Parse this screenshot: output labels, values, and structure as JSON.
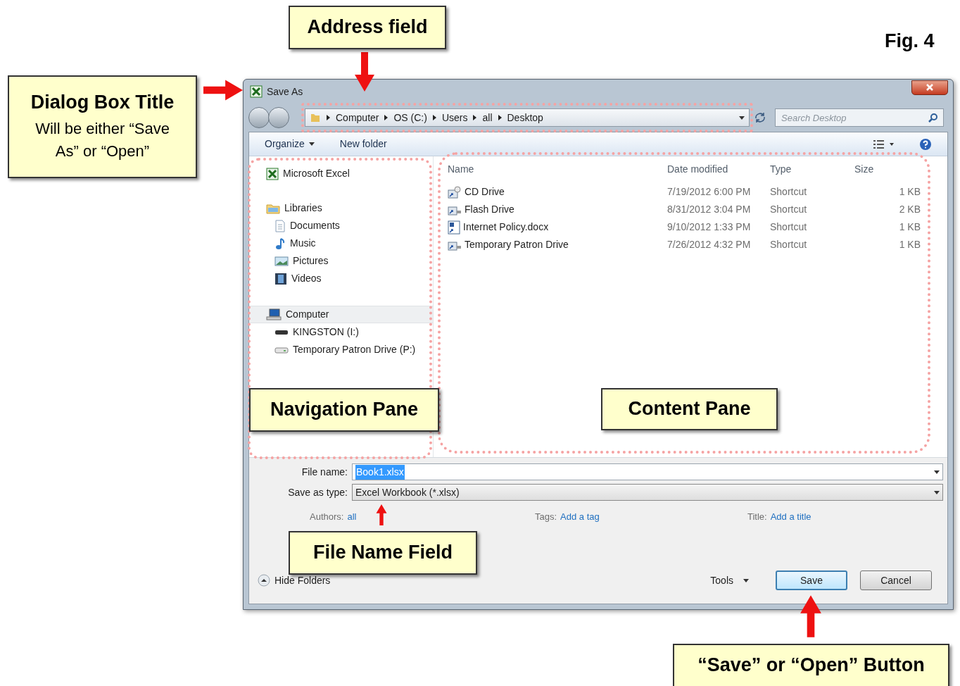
{
  "figure_label": "Fig. 4",
  "callouts": [
    {
      "title": "Address field"
    },
    {
      "title": "Dialog Box Title",
      "text": "Will be either “Save As” or “Open”"
    },
    {
      "title": "Navigation Pane"
    },
    {
      "title": "Content Pane"
    },
    {
      "title": "File Name Field"
    },
    {
      "title": "“Save” or “Open” Button"
    }
  ],
  "dialog": {
    "title": "Save As",
    "address": [
      "Computer",
      "OS (C:)",
      "Users",
      "all",
      "Desktop"
    ],
    "search": {
      "placeholder": "Search Desktop"
    },
    "toolbar": {
      "organize": "Organize",
      "new_folder": "New folder"
    },
    "navigation": [
      {
        "label": "Microsoft Excel",
        "kind": "app"
      },
      {
        "label": "Libraries",
        "kind": "library",
        "children": [
          {
            "label": "Documents",
            "kind": "documents"
          },
          {
            "label": "Music",
            "kind": "music"
          },
          {
            "label": "Pictures",
            "kind": "pictures"
          },
          {
            "label": "Videos",
            "kind": "videos"
          }
        ]
      },
      {
        "label": "Computer",
        "kind": "computer",
        "children": [
          {
            "label": "KINGSTON (I:)",
            "kind": "usb"
          },
          {
            "label": "Temporary Patron Drive (P:)",
            "kind": "network"
          }
        ]
      }
    ],
    "columns": [
      "Name",
      "Date modified",
      "Type",
      "Size"
    ],
    "files": [
      {
        "name": "CD Drive",
        "date": "7/19/2012 6:00 PM",
        "type": "Shortcut",
        "size": "1 KB",
        "kind": "cd"
      },
      {
        "name": "Flash Drive",
        "date": "8/31/2012 3:04 PM",
        "type": "Shortcut",
        "size": "2 KB",
        "kind": "drive"
      },
      {
        "name": "Internet Policy.docx",
        "date": "9/10/2012 1:33 PM",
        "type": "Shortcut",
        "size": "1 KB",
        "kind": "document"
      },
      {
        "name": "Temporary Patron Drive",
        "date": "7/26/2012 4:32 PM",
        "type": "Shortcut",
        "size": "1 KB",
        "kind": "drive"
      }
    ],
    "file_name": {
      "label": "File name:",
      "value": "Book1.xlsx"
    },
    "save_type": {
      "label": "Save as type:",
      "value": "Excel Workbook (*.xlsx)"
    },
    "metadata": [
      {
        "label": "Authors:",
        "value": "all"
      },
      {
        "label": "Tags:",
        "value": "Add a tag"
      },
      {
        "label": "Title:",
        "value": "Add a title"
      }
    ],
    "hide_folders": "Hide Folders",
    "tools": "Tools",
    "buttons": [
      {
        "label": "Save",
        "default": true
      },
      {
        "label": "Cancel",
        "default": false
      }
    ]
  }
}
